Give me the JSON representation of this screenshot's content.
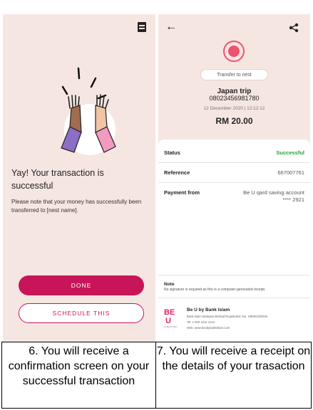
{
  "left_screen": {
    "title": "Yay! Your transaction is successful",
    "note": "Please note that your money has successfully been transferred to [nest name].",
    "done_label": "DONE",
    "schedule_label": "SCHEDULE THIS",
    "top_icon": "receipt-icon",
    "colors": {
      "primary": "#c8155a",
      "background": "#f6e6e1"
    }
  },
  "right_screen": {
    "header": {
      "back_icon": "back-arrow-icon",
      "share_icon": "share-icon"
    },
    "pill_label": "Transfer to nest",
    "trip_name": "Japan trip",
    "account_number": "08023456981780",
    "date_time": "12 December 2020 | 12:12:12",
    "amount": "RM 20.00",
    "rows": [
      {
        "label": "Status",
        "value": "Successful"
      },
      {
        "label": "Reference",
        "value": "667007761"
      },
      {
        "label": "Payment from",
        "value": "Be U qard saving account",
        "value2": "**** 2921"
      }
    ],
    "note_label": "Note",
    "note_text": "No signature is required as this is a computer-generated receipt.",
    "bank": {
      "name": "Be U by Bank Islam",
      "registration": "Bank Islam Malaysia Berhad Registration No. 198301002944",
      "tel": "Tel: 1 800 1212 1212",
      "web": "Web: www.beubybankislam.com",
      "logo_sub": "by Bank Islam"
    },
    "colors": {
      "success": "#22a33a",
      "accent": "#e8556f"
    }
  },
  "captions": {
    "left": "6. You will receive a confirmation screen on your successful transaction",
    "right": "7. You will receive a receipt on the details of your trasaction"
  }
}
